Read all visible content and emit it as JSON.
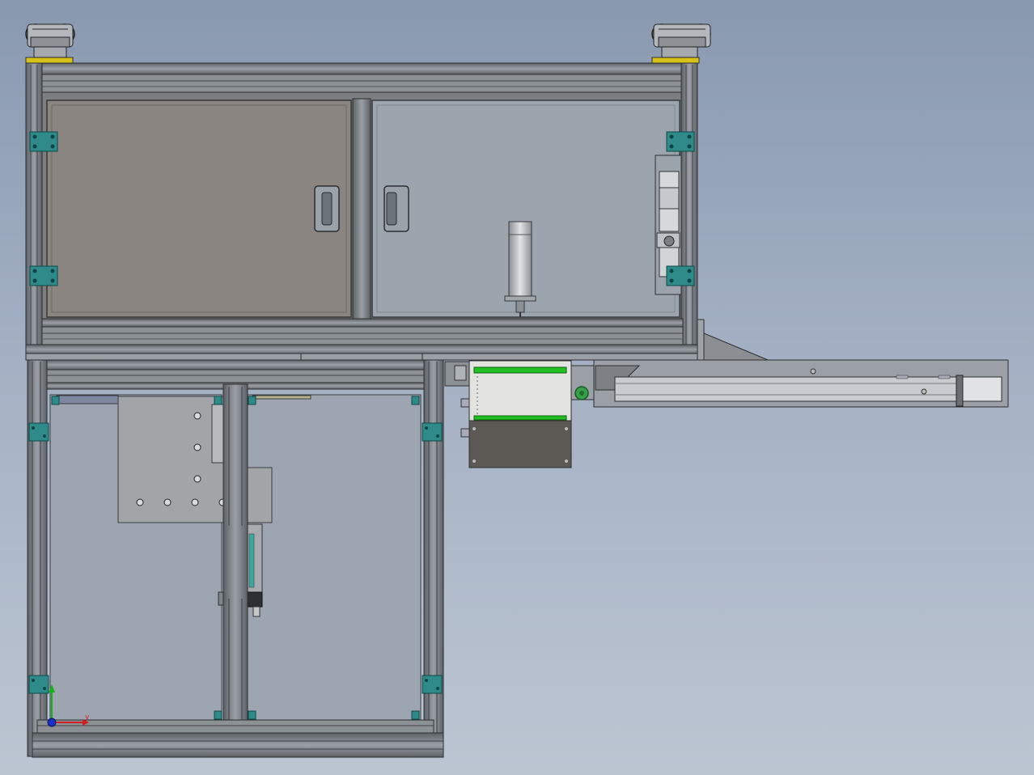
{
  "viewport": {
    "background_top": "#8999b0",
    "background_bottom": "#bcc5d2"
  },
  "colors": {
    "frame": "#858b91",
    "frame_dark": "#3a3d40",
    "panel_brown": "#8a8580",
    "panel_glass": "#9aa3ad",
    "bracket": "#2f8a8a",
    "caster_pad": "#d8c21a",
    "belt_green": "#22c022"
  },
  "triad": {
    "y_label": "y",
    "x_axis_color": "#d02020",
    "y_axis_color": "#18b018",
    "z_axis_color": "#1a2ec8"
  },
  "components": {
    "casters": 2,
    "door_handles": 2,
    "corner_brackets": 14
  }
}
